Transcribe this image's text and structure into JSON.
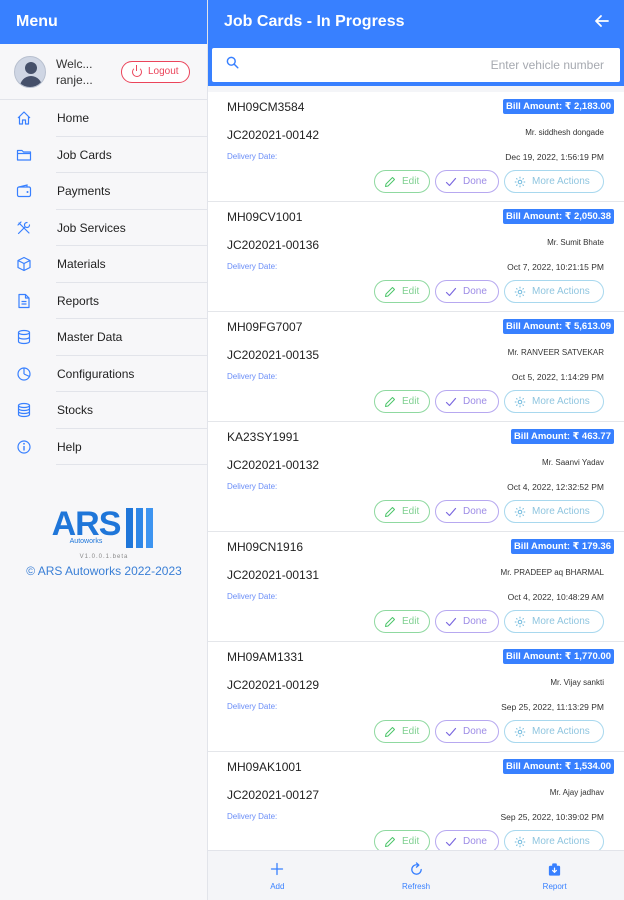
{
  "sidebar": {
    "title": "Menu",
    "user": {
      "name_line1": "Welc...",
      "name_line2": "ranje..."
    },
    "logout_label": "Logout",
    "items": [
      {
        "label": "Home",
        "icon": "home-icon"
      },
      {
        "label": "Job Cards",
        "icon": "folder-icon"
      },
      {
        "label": "Payments",
        "icon": "wallet-icon"
      },
      {
        "label": "Job Services",
        "icon": "tools-icon"
      },
      {
        "label": "Materials",
        "icon": "cube-icon"
      },
      {
        "label": "Reports",
        "icon": "document-icon"
      },
      {
        "label": "Master Data",
        "icon": "database-icon"
      },
      {
        "label": "Configurations",
        "icon": "pie-chart-icon"
      },
      {
        "label": "Stocks",
        "icon": "layers-icon"
      },
      {
        "label": "Help",
        "icon": "info-icon"
      }
    ],
    "brand": {
      "logo_text": "ARS",
      "logo_sub": "Autoworks",
      "version": "V1.0.0.1.beta",
      "copyright": "© ARS Autoworks 2022-2023"
    }
  },
  "main": {
    "title": "Job Cards - In Progress",
    "search_placeholder": "Enter vehicle number",
    "delivery_label": "Delivery Date:",
    "edit_label": "Edit",
    "done_label": "Done",
    "more_label": "More Actions",
    "cards": [
      {
        "vehicle": "MH09CM3584",
        "bill": "Bill Amount: ₹ 2,183.00",
        "jobcard": "JC202021-00142",
        "customer": "Mr. siddhesh dongade",
        "datetime": "Dec 19, 2022, 1:56:19 PM"
      },
      {
        "vehicle": "MH09CV1001",
        "bill": "Bill Amount: ₹ 2,050.38",
        "jobcard": "JC202021-00136",
        "customer": "Mr. Sumit Bhate",
        "datetime": "Oct 7, 2022, 10:21:15 PM"
      },
      {
        "vehicle": "MH09FG7007",
        "bill": "Bill Amount: ₹ 5,613.09",
        "jobcard": "JC202021-00135",
        "customer": "Mr. RANVEER SATVEKAR",
        "datetime": "Oct 5, 2022, 1:14:29 PM"
      },
      {
        "vehicle": "KA23SY1991",
        "bill": "Bill Amount: ₹ 463.77",
        "jobcard": "JC202021-00132",
        "customer": "Mr. Saanvi Yadav",
        "datetime": "Oct 4, 2022, 12:32:52 PM"
      },
      {
        "vehicle": "MH09CN1916",
        "bill": "Bill Amount: ₹ 179.36",
        "jobcard": "JC202021-00131",
        "customer": "Mr. PRADEEP aq BHARMAL",
        "datetime": "Oct 4, 2022, 10:48:29 AM"
      },
      {
        "vehicle": "MH09AM1331",
        "bill": "Bill Amount: ₹ 1,770.00",
        "jobcard": "JC202021-00129",
        "customer": "Mr. Vijay sankti",
        "datetime": "Sep 25, 2022, 11:13:29 PM"
      },
      {
        "vehicle": "MH09AK1001",
        "bill": "Bill Amount: ₹ 1,534.00",
        "jobcard": "JC202021-00127",
        "customer": "Mr. Ajay jadhav",
        "datetime": "Sep 25, 2022, 10:39:02 PM"
      }
    ]
  },
  "bottom_tabs": [
    {
      "label": "Add",
      "icon": "plus-icon"
    },
    {
      "label": "Refresh",
      "icon": "refresh-icon"
    },
    {
      "label": "Report",
      "icon": "report-icon"
    }
  ],
  "colors": {
    "primary": "#3880ff",
    "danger": "#eb445a",
    "success": "#2dd36f",
    "tertiary": "#5260ff",
    "brand": "#1f76d9"
  }
}
